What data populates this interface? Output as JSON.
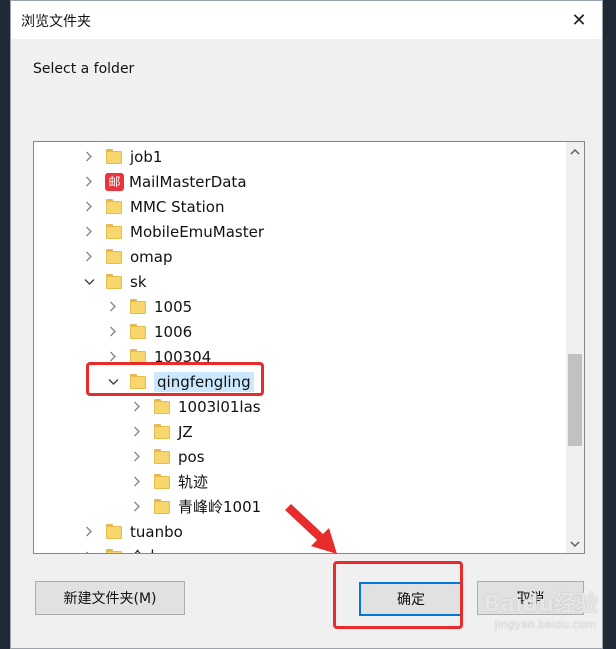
{
  "window": {
    "title": "浏览文件夹",
    "close_glyph": "✕"
  },
  "prompt": "Select a folder",
  "tree": {
    "items": [
      {
        "label": "job1",
        "indent": 0,
        "state": "collapsed",
        "icon": "folder-icon"
      },
      {
        "label": "MailMasterData",
        "indent": 0,
        "state": "collapsed",
        "icon": "mail-icon",
        "icon_text": "邮"
      },
      {
        "label": "MMC Station",
        "indent": 0,
        "state": "collapsed",
        "icon": "folder-icon"
      },
      {
        "label": "MobileEmuMaster",
        "indent": 0,
        "state": "collapsed",
        "icon": "folder-icon"
      },
      {
        "label": "omap",
        "indent": 0,
        "state": "collapsed",
        "icon": "folder-icon"
      },
      {
        "label": "sk",
        "indent": 0,
        "state": "expanded",
        "icon": "folder-icon"
      },
      {
        "label": "1005",
        "indent": 1,
        "state": "collapsed",
        "icon": "folder-icon"
      },
      {
        "label": "1006",
        "indent": 1,
        "state": "collapsed",
        "icon": "folder-icon"
      },
      {
        "label": "100304",
        "indent": 1,
        "state": "collapsed",
        "icon": "folder-icon"
      },
      {
        "label": "qingfengling",
        "indent": 1,
        "state": "expanded",
        "icon": "folder-icon",
        "selected": true
      },
      {
        "label": "1003l01las",
        "indent": 2,
        "state": "collapsed",
        "icon": "folder-icon"
      },
      {
        "label": "JZ",
        "indent": 2,
        "state": "collapsed",
        "icon": "folder-icon"
      },
      {
        "label": "pos",
        "indent": 2,
        "state": "collapsed",
        "icon": "folder-icon"
      },
      {
        "label": "轨迹",
        "indent": 2,
        "state": "collapsed",
        "icon": "folder-icon"
      },
      {
        "label": "青峰岭1001",
        "indent": 2,
        "state": "collapsed",
        "icon": "folder-icon"
      },
      {
        "label": "tuanbo",
        "indent": 0,
        "state": "collapsed",
        "icon": "folder-icon"
      },
      {
        "label": "个人",
        "indent": 0,
        "state": "collapsed",
        "icon": "folder-icon"
      }
    ]
  },
  "buttons": {
    "new_folder": "新建文件夹(M)",
    "ok": "确定",
    "cancel": "取消"
  },
  "watermark": {
    "brand": "Baidu经验",
    "url": "jingyan.baidu.com"
  },
  "colors": {
    "highlight": "#e82c2c",
    "selection": "#cce8ff",
    "folder": "#f8d66e"
  }
}
